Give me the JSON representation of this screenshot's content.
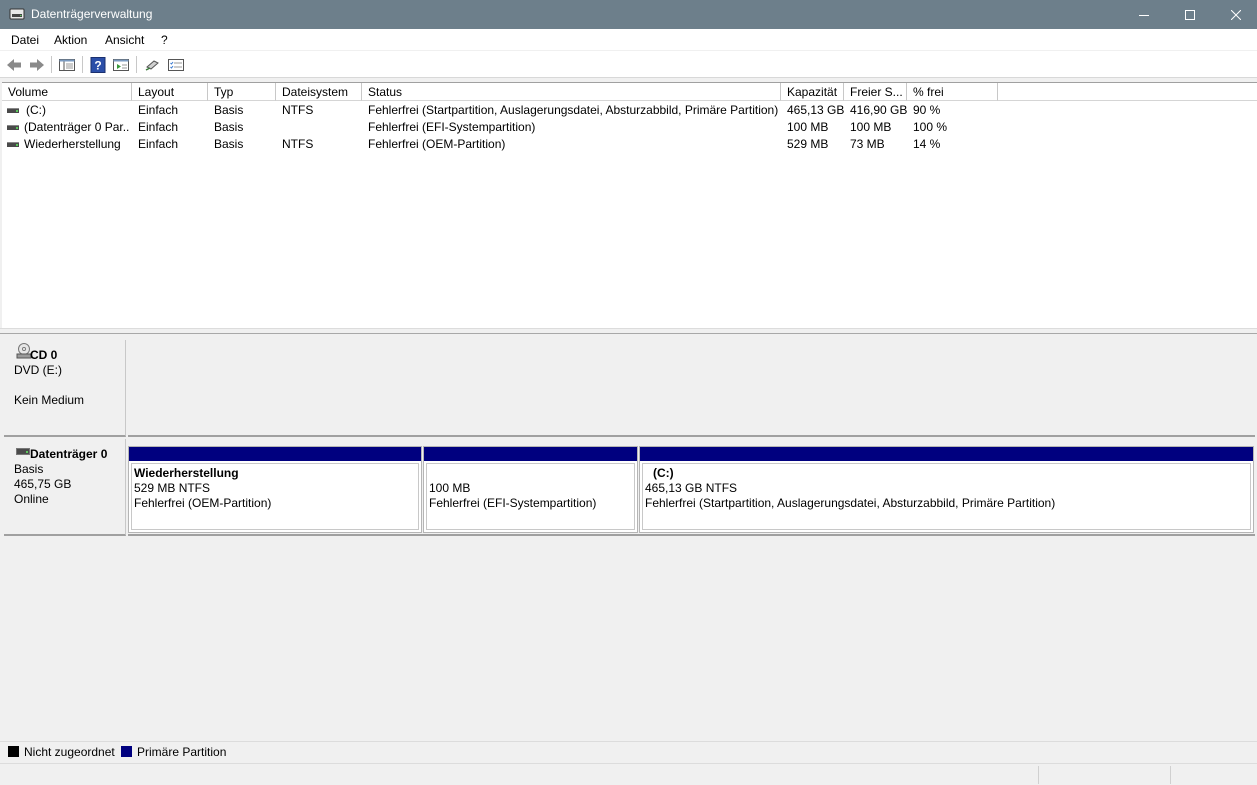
{
  "window": {
    "title": "Datenträgerverwaltung",
    "minimize_icon": "minimize-icon",
    "maximize_icon": "maximize-icon",
    "close_icon": "close-icon"
  },
  "menu": [
    "Datei",
    "Aktion",
    "Ansicht",
    "?"
  ],
  "toolbar": {
    "icons": [
      "back-arrow-icon",
      "forward-arrow-icon",
      "console-tree-icon",
      "help-icon",
      "properties-icon",
      "connect-icon",
      "disk-list-icon"
    ]
  },
  "volume_list": {
    "columns": [
      "Volume",
      "Layout",
      "Typ",
      "Dateisystem",
      "Status",
      "Kapazität",
      "Freier S...",
      "% frei"
    ],
    "rows": [
      [
        "(C:)",
        "Einfach",
        "Basis",
        "NTFS",
        "Fehlerfrei (Startpartition, Auslagerungsdatei, Absturzabbild, Primäre Partition)",
        "465,13 GB",
        "416,90 GB",
        "90 %"
      ],
      [
        "(Datenträger 0 Par...",
        "Einfach",
        "Basis",
        "",
        "Fehlerfrei (EFI-Systempartition)",
        "100 MB",
        "100 MB",
        "100 %"
      ],
      [
        "Wiederherstellung",
        "Einfach",
        "Basis",
        "NTFS",
        "Fehlerfrei (OEM-Partition)",
        "529 MB",
        "73 MB",
        "14 %"
      ]
    ]
  },
  "disks": {
    "cd": {
      "name": "CD 0",
      "drive": "DVD (E:)",
      "media": "Kein Medium",
      "icon": "cd-drive-icon"
    },
    "disk0": {
      "name": "Datenträger 0",
      "type": "Basis",
      "size": "465,75 GB",
      "state": "Online",
      "icon": "hard-disk-icon",
      "partitions": [
        {
          "title": "Wiederherstellung",
          "size": "529 MB NTFS",
          "status": "Fehlerfrei (OEM-Partition)"
        },
        {
          "title": "",
          "size": "100 MB",
          "status": "Fehlerfrei (EFI-Systempartition)"
        },
        {
          "title": "(C:)",
          "size": "465,13 GB NTFS",
          "status": "Fehlerfrei (Startpartition, Auslagerungsdatei, Absturzabbild, Primäre Partition)"
        }
      ]
    }
  },
  "legend": [
    {
      "label": "Nicht zugeordnet",
      "color": "#000000"
    },
    {
      "label": "Primäre Partition",
      "color": "#00007f"
    }
  ]
}
